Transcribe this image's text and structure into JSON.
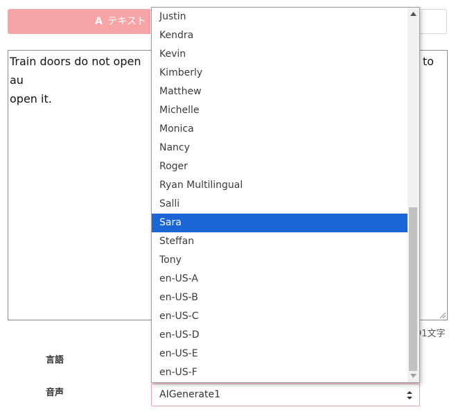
{
  "tabs": {
    "text_tab": {
      "icon": "font-icon",
      "icon_glyph": "A",
      "label": "テキスト"
    }
  },
  "editor": {
    "text_line1_left": "Train doors do not open au",
    "text_line1_right": "to",
    "text_line2": "open it.",
    "char_count": "91文字"
  },
  "labels": {
    "language": "言語",
    "voice": "音声"
  },
  "voice_select": {
    "value": "AIGenerate1"
  },
  "dropdown": {
    "options": [
      "Justin",
      "Kendra",
      "Kevin",
      "Kimberly",
      "Matthew",
      "Michelle",
      "Monica",
      "Nancy",
      "Roger",
      "Ryan Multilingual",
      "Salli",
      "Sara",
      "Steffan",
      "Tony",
      "en-US-A",
      "en-US-B",
      "en-US-C",
      "en-US-D",
      "en-US-E",
      "en-US-F"
    ],
    "selected": "Sara",
    "scroll_position_fraction": 0.55
  },
  "colors": {
    "tab_bg": "#f7a4a6",
    "selected_bg": "#1a66d6",
    "select_border": "#f2a0a8"
  }
}
